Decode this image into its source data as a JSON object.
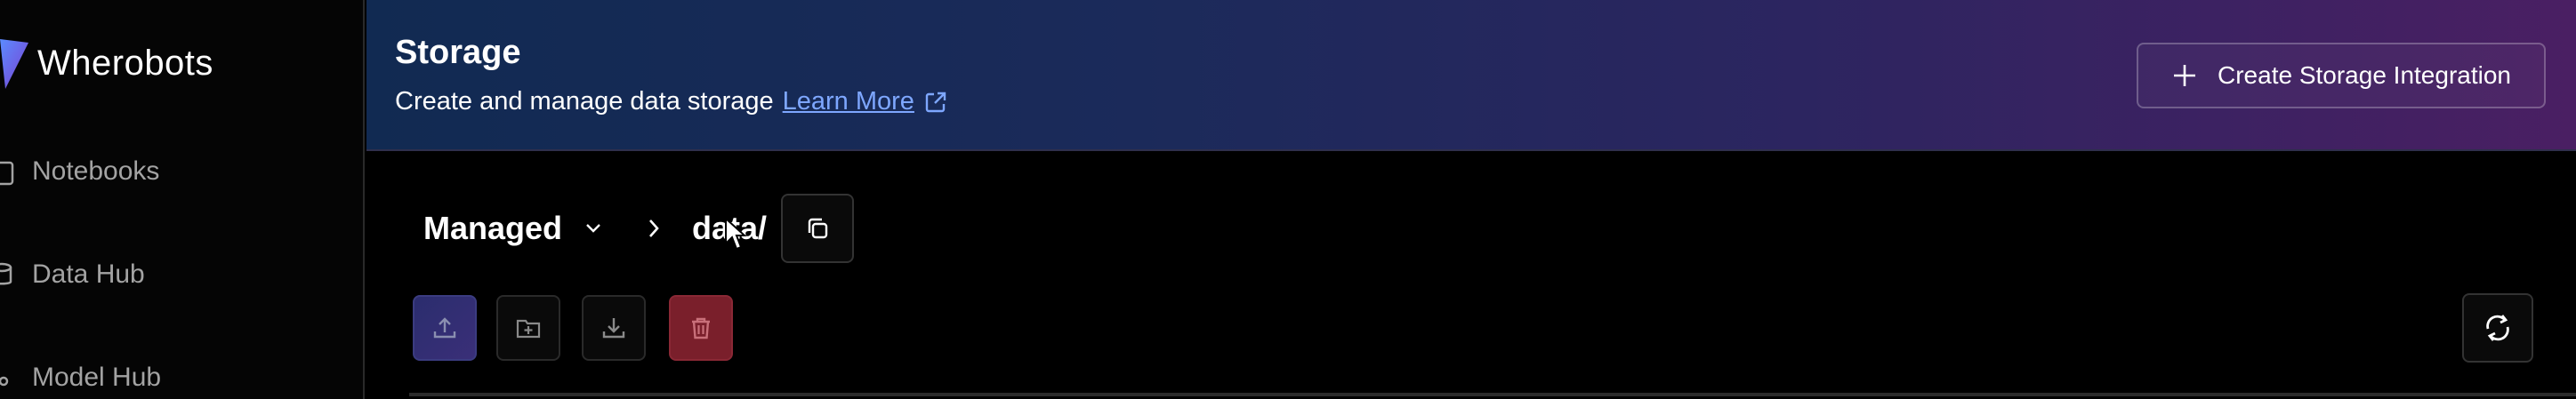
{
  "sidebar": {
    "brand": "Wherobots",
    "items": [
      {
        "label": "Notebooks",
        "icon": "notebook-icon"
      },
      {
        "label": "Data Hub",
        "icon": "database-icon"
      },
      {
        "label": "Model Hub",
        "icon": "model-icon"
      }
    ]
  },
  "header": {
    "title": "Storage",
    "subtitle": "Create and manage data storage",
    "learn_more": "Learn More",
    "create_button": "Create Storage Integration"
  },
  "breadcrumb": {
    "storage_type": "Managed",
    "path": "data/"
  },
  "toolbar": {
    "icons": [
      "upload-icon",
      "new-folder-icon",
      "download-icon",
      "trash-icon",
      "refresh-icon"
    ]
  },
  "colors": {
    "accent_link": "#7ea7ff",
    "delete": "#7a1f2b",
    "upload": "#2b2d6e",
    "header_start": "#112a52",
    "header_end": "#4a1f63"
  }
}
